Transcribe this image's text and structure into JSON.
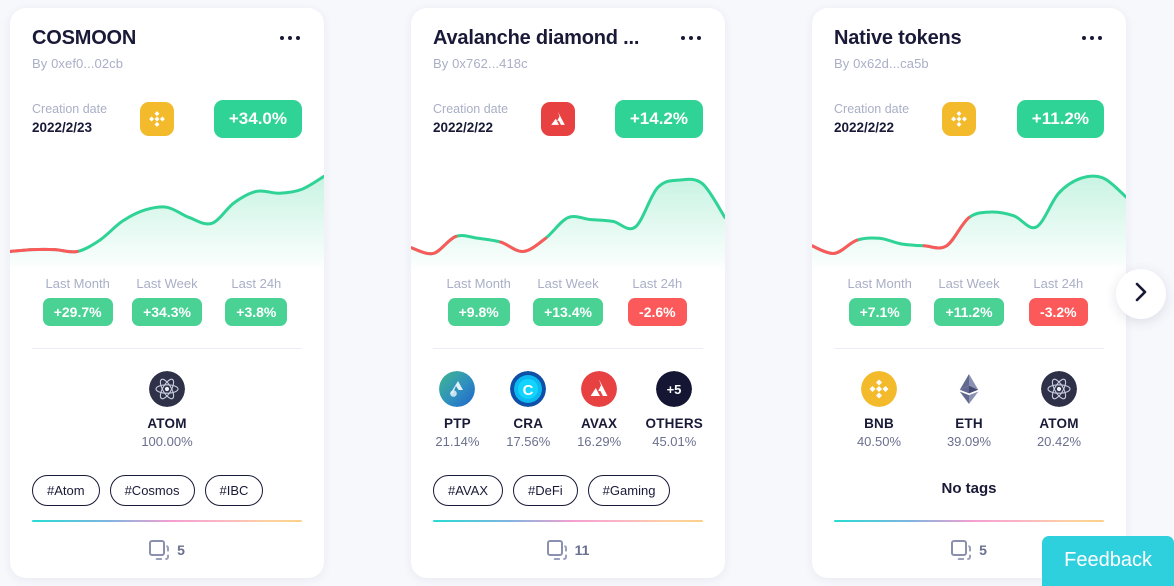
{
  "theme": {
    "page_bg": "#f7f8fc",
    "accent_green": "#2fd396",
    "accent_red": "#fc5a5a",
    "feedback_cyan": "#2ed0dd",
    "text_dark": "#181a37",
    "text_muted": "#a9afc6"
  },
  "stat_labels": {
    "month": "Last Month",
    "week": "Last Week",
    "day": "Last 24h"
  },
  "cards": [
    {
      "title": "COSMOON",
      "author": "By 0xef0...02cb",
      "creation_label": "Creation date",
      "creation_date": "2022/2/23",
      "chain_icon": "bnb-chain-icon",
      "main_change": "+34.0%",
      "main_change_positive": true,
      "stats": [
        {
          "label": "Last Month",
          "value": "+29.7%",
          "positive": true
        },
        {
          "label": "Last Week",
          "value": "+34.3%",
          "positive": true
        },
        {
          "label": "Last 24h",
          "value": "+3.8%",
          "positive": true
        }
      ],
      "tokens": [
        {
          "symbol": "ATOM",
          "percent": "100.00%",
          "icon": "atom-token-icon"
        }
      ],
      "tags": [
        "#Atom",
        "#Cosmos",
        "#IBC"
      ],
      "no_tags_label": "",
      "copies": "5"
    },
    {
      "title": "Avalanche diamond ...",
      "author": "By 0x762...418c",
      "creation_label": "Creation date",
      "creation_date": "2022/2/22",
      "chain_icon": "avalanche-chain-icon",
      "main_change": "+14.2%",
      "main_change_positive": true,
      "stats": [
        {
          "label": "Last Month",
          "value": "+9.8%",
          "positive": true
        },
        {
          "label": "Last Week",
          "value": "+13.4%",
          "positive": true
        },
        {
          "label": "Last 24h",
          "value": "-2.6%",
          "positive": false
        }
      ],
      "tokens": [
        {
          "symbol": "PTP",
          "percent": "21.14%",
          "icon": "ptp-token-icon"
        },
        {
          "symbol": "CRA",
          "percent": "17.56%",
          "icon": "cra-token-icon"
        },
        {
          "symbol": "AVAX",
          "percent": "16.29%",
          "icon": "avax-token-icon"
        },
        {
          "symbol": "OTHERS",
          "percent": "45.01%",
          "icon": "others-token-icon",
          "badge": "+5"
        }
      ],
      "tags": [
        "#AVAX",
        "#DeFi",
        "#Gaming"
      ],
      "no_tags_label": "",
      "copies": "11"
    },
    {
      "title": "Native tokens",
      "author": "By 0x62d...ca5b",
      "creation_label": "Creation date",
      "creation_date": "2022/2/22",
      "chain_icon": "bnb-chain-icon",
      "main_change": "+11.2%",
      "main_change_positive": true,
      "stats": [
        {
          "label": "Last Month",
          "value": "+7.1%",
          "positive": true
        },
        {
          "label": "Last Week",
          "value": "+11.2%",
          "positive": true
        },
        {
          "label": "Last 24h",
          "value": "-3.2%",
          "positive": false
        }
      ],
      "tokens": [
        {
          "symbol": "BNB",
          "percent": "40.50%",
          "icon": "bnb-token-icon"
        },
        {
          "symbol": "ETH",
          "percent": "39.09%",
          "icon": "eth-token-icon"
        },
        {
          "symbol": "ATOM",
          "percent": "20.42%",
          "icon": "atom-token-icon"
        }
      ],
      "tags": [],
      "no_tags_label": "No tags",
      "copies": "5"
    }
  ],
  "next_arrow_icon": "chevron-right-icon",
  "feedback": {
    "label": "Feedback"
  },
  "chart_data": [
    {
      "type": "area",
      "title": "COSMOON performance sparkline",
      "xlabel": "",
      "ylabel": "",
      "grid": false,
      "legend": null,
      "x": [
        0,
        1,
        2,
        3,
        4,
        5,
        6,
        7,
        8,
        9,
        10,
        11,
        12,
        13,
        14
      ],
      "values": [
        8,
        10,
        10,
        8,
        20,
        40,
        52,
        55,
        44,
        38,
        60,
        72,
        70,
        74,
        88
      ],
      "ylim": [
        0,
        100
      ],
      "line_color": "#2fd396",
      "negative_segment_color": "#fc5a5a",
      "negative_segments": [
        [
          0,
          3
        ]
      ]
    },
    {
      "type": "area",
      "title": "Avalanche diamond performance sparkline",
      "xlabel": "",
      "ylabel": "",
      "grid": false,
      "legend": null,
      "x": [
        0,
        1,
        2,
        3,
        4,
        5,
        6,
        7,
        8,
        9,
        10,
        11,
        12,
        13,
        14
      ],
      "values": [
        12,
        6,
        24,
        22,
        18,
        8,
        22,
        44,
        42,
        40,
        34,
        76,
        84,
        80,
        44
      ],
      "ylim": [
        0,
        100
      ],
      "line_color": "#2fd396",
      "negative_segment_color": "#fc5a5a",
      "negative_segments": [
        [
          0,
          2
        ],
        [
          4,
          6
        ]
      ]
    },
    {
      "type": "area",
      "title": "Native tokens performance sparkline",
      "xlabel": "",
      "ylabel": "",
      "grid": false,
      "legend": null,
      "x": [
        0,
        1,
        2,
        3,
        4,
        5,
        6,
        7,
        8,
        9,
        10,
        11,
        12,
        13,
        14
      ],
      "values": [
        14,
        6,
        20,
        22,
        16,
        14,
        14,
        44,
        50,
        46,
        34,
        70,
        86,
        86,
        66
      ],
      "ylim": [
        0,
        100
      ],
      "line_color": "#2fd396",
      "negative_segment_color": "#fc5a5a",
      "negative_segments": [
        [
          0,
          2
        ],
        [
          5,
          7
        ]
      ]
    }
  ]
}
